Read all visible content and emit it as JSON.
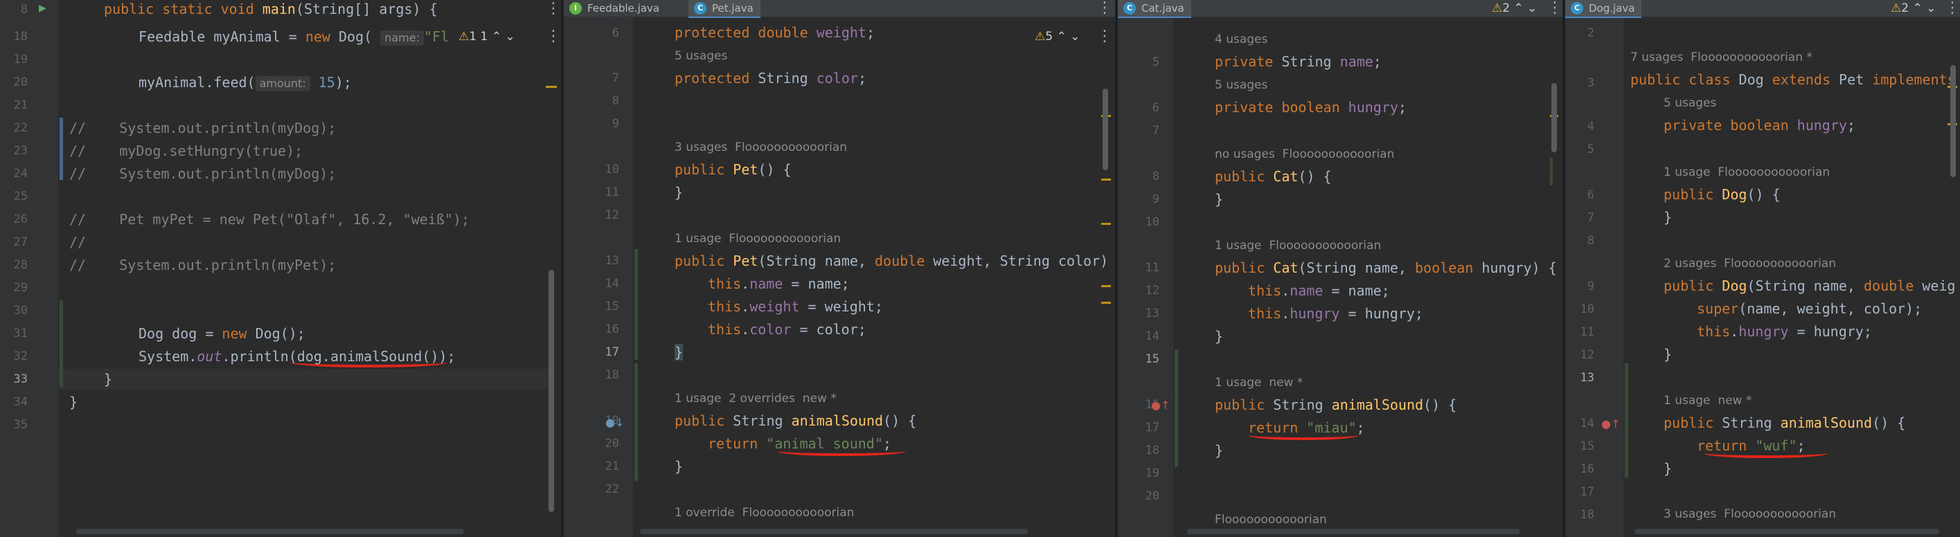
{
  "panes": {
    "main": {
      "line_numbers": [
        "8",
        "18",
        "19",
        "20",
        "21",
        "22",
        "23",
        "24",
        "25",
        "26",
        "27",
        "28",
        "29",
        "30",
        "31",
        "32",
        "33",
        "34",
        "35"
      ],
      "line1": {
        "kw": "public static void ",
        "fn": "main",
        "rest": "(String[] args) {"
      },
      "line2": {
        "a": "Feedable myAnimal = ",
        "kw": "new ",
        "b": "Dog(",
        "hint": "name:",
        "str": "\"Fl"
      },
      "line2_warn": "1 1",
      "line3": {
        "a": "myAnimal.feed(",
        "hint": "amount:",
        "num": "15",
        "b": ");"
      },
      "line4": {
        "cm": "//",
        "code": "    System.out.println(myDog);"
      },
      "line5": {
        "cm": "//",
        "code": "    myDog.setHungry(true);"
      },
      "line6": {
        "cm": "//",
        "code": "    System.out.println(myDog);"
      },
      "line7": {
        "cm": "//",
        "code": "    Pet myPet = new Pet(\"Olaf\", 16.2, \"weiß\");"
      },
      "line8": {
        "cm": "//",
        "code": ""
      },
      "line9": {
        "cm": "//",
        "code": "    System.out.println(myPet);"
      },
      "line10": {
        "a": "Dog dog = ",
        "kw": "new ",
        "b": "Dog();"
      },
      "line11": {
        "a": "System.",
        "fld": "out",
        "b": ".println(",
        "c": "dog.animalSound());"
      },
      "line12": "}",
      "line13": "}"
    },
    "pet": {
      "tabs": [
        "Feedable.java",
        "Pet.java"
      ],
      "warn": "5",
      "line_numbers": [
        "6",
        "7",
        "8",
        "9",
        "10",
        "11",
        "12",
        "13",
        "14",
        "15",
        "16",
        "17",
        "18",
        "19",
        "20",
        "21",
        "22"
      ],
      "usages_5": "5 usages",
      "usages_3": "3 usages  Flooooooooooorian",
      "usage_1": "1 usage  Flooooooooooorian",
      "usage_overrides": "1 usage  2 overrides  new *",
      "override": "1 override  Flooooooooooorian",
      "l_weight": {
        "kw": "protected double ",
        "fld": "weight",
        "b": ";"
      },
      "l_color": {
        "kw": "protected ",
        "a": "String ",
        "fld": "color",
        "b": ";"
      },
      "l_ctor1": {
        "kw": "public ",
        "fn": "Pet",
        "b": "() {"
      },
      "l_close1": "}",
      "l_ctor2": {
        "kw": "public ",
        "fn": "Pet",
        "b": "(String name, ",
        "kw2": "double ",
        "c": "weight, String color)"
      },
      "l_name": {
        "kw": "this",
        "a": ".",
        "fld": "name",
        "b": " = name;"
      },
      "l_w": {
        "kw": "this",
        "a": ".",
        "fld": "weight",
        "b": " = weight;"
      },
      "l_c": {
        "kw": "this",
        "a": ".",
        "fld": "color",
        "b": " = color;"
      },
      "l_close2": "}",
      "l_sound": {
        "kw": "public ",
        "a": "String ",
        "fn": "animalSound",
        "b": "() {"
      },
      "l_return": {
        "kw": "return ",
        "str": "\"animal sound\"",
        "b": ";"
      },
      "l_close3": "}"
    },
    "cat": {
      "tab": "Cat.java",
      "warn": "2",
      "line_numbers": [
        "5",
        "6",
        "7",
        "8",
        "9",
        "10",
        "11",
        "12",
        "13",
        "14",
        "15",
        "16",
        "17",
        "18",
        "19",
        "20"
      ],
      "usages_4": "4 usages",
      "usages_5": "5 usages",
      "no_usages": "no usages  Flooooooooooorian",
      "usage_1": "1 usage  Flooooooooooorian",
      "usage_new": "1 usage  new *",
      "author": "Flooooooooooorian",
      "l_name": {
        "kw": "private ",
        "a": "String ",
        "fld": "name",
        "b": ";"
      },
      "l_hungry": {
        "kw": "private boolean ",
        "fld": "hungry",
        "b": ";"
      },
      "l_ctor1": {
        "kw": "public ",
        "fn": "Cat",
        "b": "() {"
      },
      "l_close1": "}",
      "l_ctor2": {
        "kw": "public ",
        "fn": "Cat",
        "b": "(String name, ",
        "kw2": "boolean ",
        "c": "hungry) {"
      },
      "l_n": {
        "kw": "this",
        "a": ".",
        "fld": "name",
        "b": " = name;"
      },
      "l_h": {
        "kw": "this",
        "a": ".",
        "fld": "hungry",
        "b": " = hungry;"
      },
      "l_close2": "}",
      "l_sound": {
        "kw": "public ",
        "a": "String ",
        "fn": "animalSound",
        "b": "() {"
      },
      "l_return": {
        "kw": "return ",
        "str": "\"miau\"",
        "b": ";"
      },
      "l_close3": "}"
    },
    "dog": {
      "tab": "Dog.java",
      "warn": "2",
      "line_numbers": [
        "2",
        "3",
        "4",
        "5",
        "6",
        "7",
        "8",
        "9",
        "10",
        "11",
        "12",
        "13",
        "14",
        "15",
        "16",
        "17",
        "18"
      ],
      "usages_7": "7 usages  Flooooooooooorian *",
      "usages_5": "5 usages",
      "usage_1": "1 usage  Flooooooooooorian",
      "usages_2": "2 usages  Flooooooooooorian",
      "usage_new": "1 usage  new *",
      "usages_3": "3 usages  Flooooooooooorian",
      "l_class": {
        "kw": "public class ",
        "a": "Dog ",
        "kw2": "extends ",
        "b": "Pet ",
        "kw3": "implements"
      },
      "l_hungry": {
        "kw": "private boolean ",
        "fld": "hungry",
        "b": ";"
      },
      "l_ctor1": {
        "kw": "public ",
        "fn": "Dog",
        "b": "() {"
      },
      "l_close1": "}",
      "l_ctor2": {
        "kw": "public ",
        "fn": "Dog",
        "b": "(String name, ",
        "kw2": "double ",
        "c": "weig"
      },
      "l_super": {
        "kw": "super",
        "b": "(name, weight, color);"
      },
      "l_h": {
        "kw": "this",
        "a": ".",
        "fld": "hungry",
        "b": " = hungry;"
      },
      "l_close2": "}",
      "l_sound": {
        "kw": "public ",
        "a": "String ",
        "fn": "animalSound",
        "b": "() {"
      },
      "l_return": {
        "kw": "return ",
        "str": "\"wuf\"",
        "b": ";"
      },
      "l_close3": "}"
    }
  },
  "colors": {
    "keyword": "#cc7832",
    "string": "#6a8759",
    "field": "#9876aa",
    "method": "#ffc66d",
    "number": "#6897bb",
    "underline": "#e0251b"
  },
  "icons": [
    "run-icon",
    "java-class-icon",
    "interface-icon",
    "warning-icon",
    "override-icon",
    "implemented-icon",
    "more-options-icon"
  ]
}
